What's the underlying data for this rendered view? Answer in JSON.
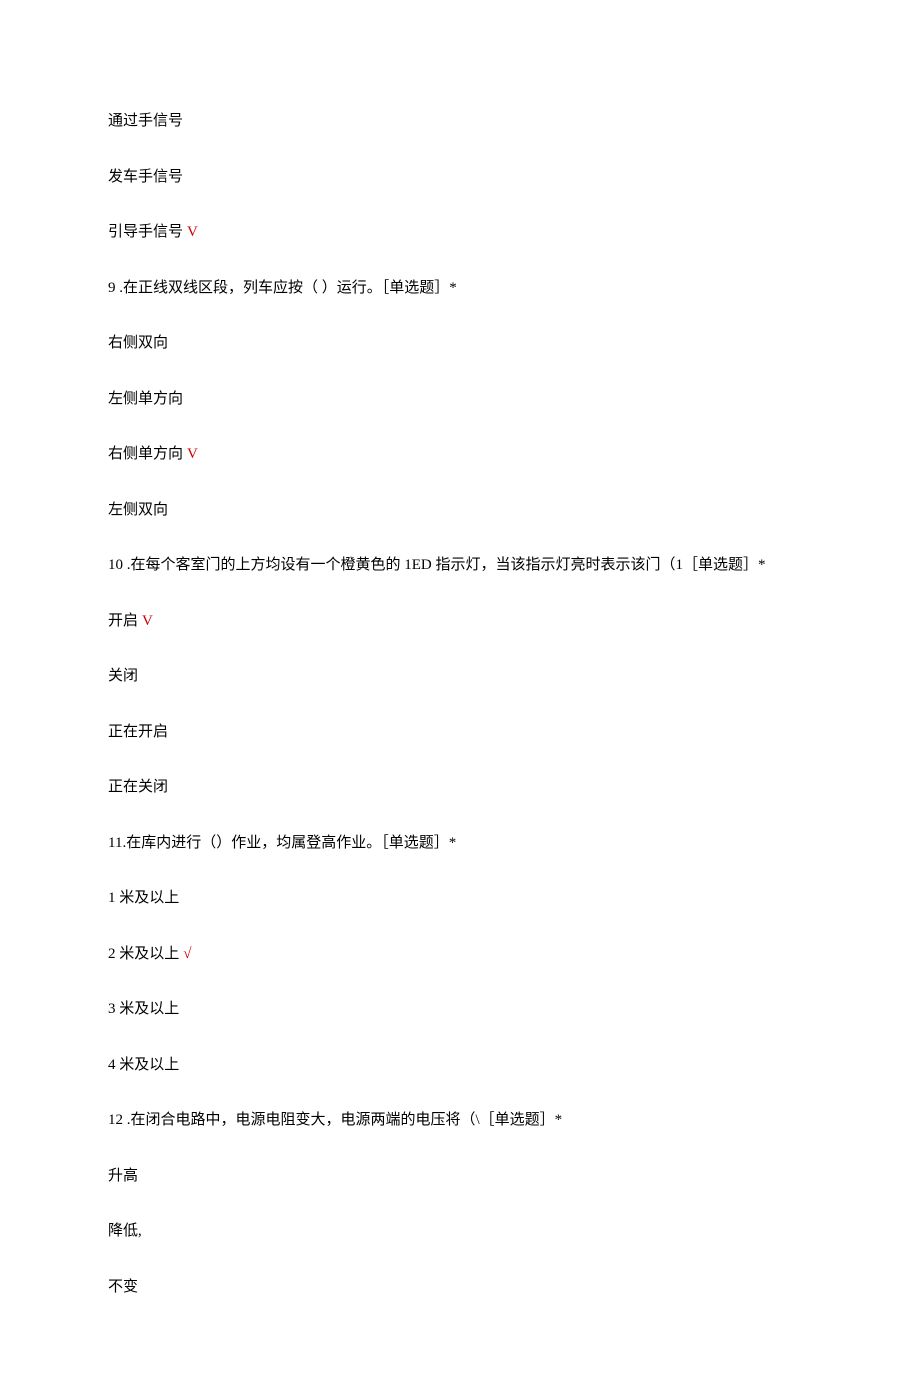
{
  "lines": {
    "opt_q8_a": "通过手信号",
    "opt_q8_b": "发车手信号",
    "opt_q8_c_text": "引导手信号",
    "opt_q8_c_mark": "V",
    "q9_text": "9  .在正线双线区段，列车应按（ ）运行。［单选题］*",
    "opt_q9_a": "右侧双向",
    "opt_q9_b": "左侧单方向",
    "opt_q9_c_text": "右侧单方向",
    "opt_q9_c_mark": "V",
    "opt_q9_d": "左侧双向",
    "q10_text": "10  .在每个客室门的上方均设有一个橙黄色的 1ED 指示灯，当该指示灯亮时表示该门（1［单选题］*",
    "opt_q10_a_text": "开启",
    "opt_q10_a_mark": "V",
    "opt_q10_b": "关闭",
    "opt_q10_c": "正在开启",
    "opt_q10_d": "正在关闭",
    "q11_text": "11.在库内进行（）作业，均属登高作业。［单选题］*",
    "opt_q11_a": "1 米及以上",
    "opt_q11_b_text": "2 米及以上",
    "opt_q11_b_mark": "√",
    "opt_q11_c": "3 米及以上",
    "opt_q11_d": "4 米及以上",
    "q12_text": "12  .在闭合电路中，电源电阻变大，电源两端的电压将（\\［单选题］*",
    "opt_q12_a": "升高",
    "opt_q12_b": "降低,",
    "opt_q12_c": "不变"
  }
}
